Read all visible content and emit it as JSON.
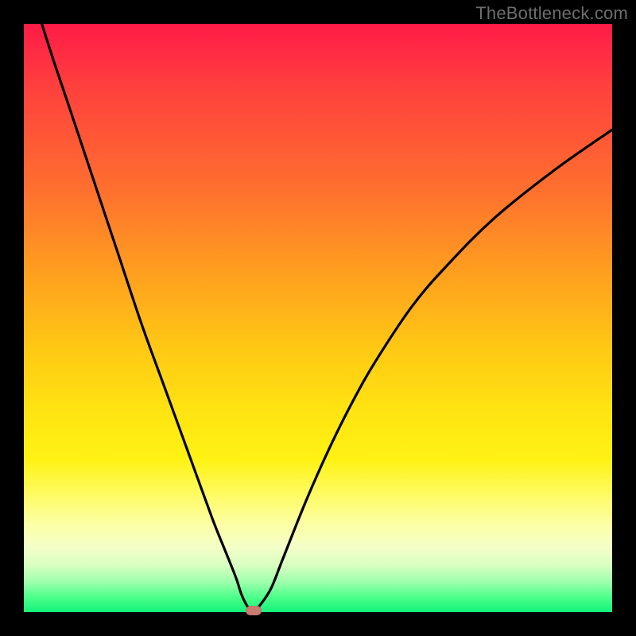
{
  "watermark": "TheBottleneck.com",
  "colors": {
    "frame": "#000000",
    "curve": "#000000",
    "marker": "#c97b70",
    "gradient_top": "#ff1b47",
    "gradient_mid_orange": "#ff9e1f",
    "gradient_mid_yellow": "#ffe412",
    "gradient_bottom": "#14f27a"
  },
  "chart_data": {
    "type": "line",
    "title": "",
    "xlabel": "",
    "ylabel": "",
    "xlim": [
      0,
      100
    ],
    "ylim": [
      0,
      100
    ],
    "x": [
      0,
      4,
      8,
      12,
      16,
      20,
      24,
      28,
      32,
      34,
      36,
      37,
      38,
      39,
      40,
      42,
      44,
      48,
      52,
      56,
      60,
      66,
      72,
      80,
      90,
      100
    ],
    "values": [
      110,
      97,
      85,
      73,
      61,
      49,
      38,
      27,
      16,
      11,
      6,
      3,
      1,
      0,
      1,
      4,
      9,
      19,
      28,
      36,
      43,
      52,
      59,
      67,
      75,
      82
    ],
    "minimum_x": 39,
    "minimum_y": 0,
    "interpretation": "V-shaped bottleneck curve; minimum at x≈39 where bottleneck ≈ 0%. Background gradient encodes bottleneck severity (green=low, red=high).",
    "marker": {
      "x": 39,
      "y": 0
    }
  }
}
